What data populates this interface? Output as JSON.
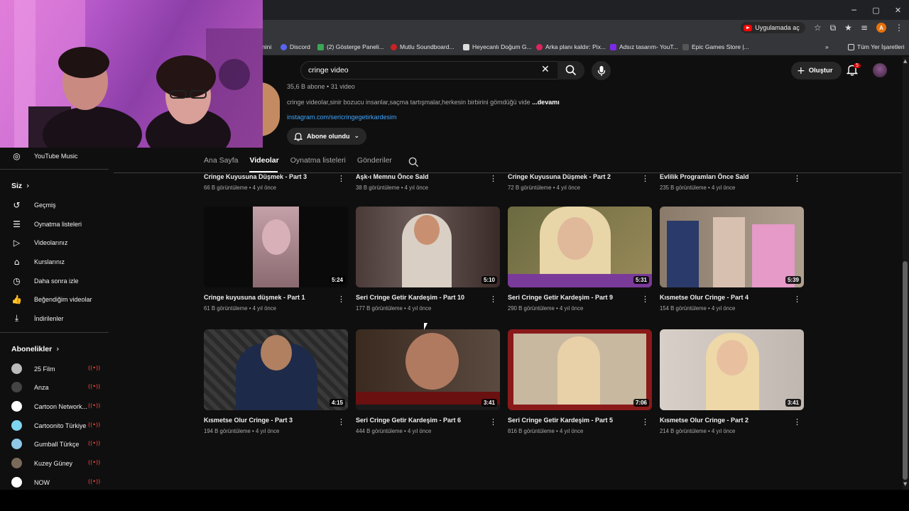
{
  "window": {
    "minimize": "─",
    "maximize": "▢",
    "close": "✕"
  },
  "toolbar": {
    "open_app_label": "Uygulamada aç",
    "profile_initial": "A"
  },
  "bookmarks": [
    {
      "label": "nini",
      "color": "#888888"
    },
    {
      "label": "Discord",
      "color": "#5865f2"
    },
    {
      "label": "(2) Gösterge Paneli...",
      "color": "#3aa757"
    },
    {
      "label": "Mutlu Soundboard...",
      "color": "#cc2222"
    },
    {
      "label": "Heyecanlı Doğum G...",
      "color": "#dddddd"
    },
    {
      "label": "Arka planı kaldır: Pix...",
      "color": "#e0245e"
    },
    {
      "label": "Adsız tasarım- YouT...",
      "color": "#7d2ae8"
    },
    {
      "label": "Epic Games Store |...",
      "color": "#333333"
    }
  ],
  "bookmarks_all": "Tüm Yer İşaretleri",
  "search": {
    "query": "cringe video"
  },
  "header": {
    "create_label": "Oluştur",
    "notif_count": "5"
  },
  "channel": {
    "meta": "35,6 B abone • 31 video",
    "description": "cringe videolar,sinir bozucu insanlar,saçma tartışmalar,herkesin birbirini gömdüğü vide",
    "more": "...devamı",
    "link": "instagram.com/sericringegetirkardesim",
    "subscribed_label": "Abone olundu"
  },
  "tabs": [
    {
      "label": "Ana Sayfa",
      "active": false
    },
    {
      "label": "Videolar",
      "active": true
    },
    {
      "label": "Oynatma listeleri",
      "active": false
    },
    {
      "label": "Gönderiler",
      "active": false
    }
  ],
  "sidebar": {
    "music": {
      "label": "YouTube Music",
      "icon": "youtube-music-icon"
    },
    "you_heading": "Siz",
    "you_items": [
      {
        "label": "Geçmiş",
        "icon": "history-icon"
      },
      {
        "label": "Oynatma listeleri",
        "icon": "playlists-icon"
      },
      {
        "label": "Videolarınız",
        "icon": "your-videos-icon"
      },
      {
        "label": "Kurslarınız",
        "icon": "courses-icon"
      },
      {
        "label": "Daha sonra izle",
        "icon": "watch-later-icon"
      },
      {
        "label": "Beğendiğim videolar",
        "icon": "liked-icon"
      },
      {
        "label": "İndirilenler",
        "icon": "download-icon"
      }
    ],
    "subs_heading": "Abonelikler",
    "subscriptions": [
      {
        "label": "25 Film",
        "color": "#bbbbbb",
        "live": true
      },
      {
        "label": "Anza",
        "color": "#444444",
        "live": true
      },
      {
        "label": "Cartoon Network...",
        "color": "#ffffff",
        "live": true
      },
      {
        "label": "Cartoonito Türkiye",
        "color": "#7fd4f0",
        "live": true
      },
      {
        "label": "Gumball Türkçe",
        "color": "#8fc8e8",
        "live": true
      },
      {
        "label": "Kuzey Güney",
        "color": "#7a6a5a",
        "live": true
      },
      {
        "label": "NOW",
        "color": "#ffffff",
        "live": true
      }
    ]
  },
  "videos_row0": [
    {
      "title": "Cringe Kuyusuna Düşmek - Part 3",
      "meta": "66 B görüntüleme • 4 yıl önce"
    },
    {
      "title": "Aşk-ı Memnu Önce Sald",
      "meta": "38 B görüntüleme • 4 yıl önce"
    },
    {
      "title": "Cringe Kuyusuna Düşmek - Part 2",
      "meta": "72 B görüntüleme • 4 yıl önce"
    },
    {
      "title": "Evlilik Programları Önce Sald",
      "meta": "235 B görüntüleme • 4 yıl önce"
    }
  ],
  "videos_row1": [
    {
      "title": "Cringe kuyusuna düşmek - Part 1",
      "meta": "61 B görüntüleme • 4 yıl önce",
      "duration": "5:24",
      "colors": [
        "#0a0a0a",
        "#a08090"
      ]
    },
    {
      "title": "Seri Cringe Getir Kardeşim - Part 10",
      "meta": "177 B görüntüleme • 4 yıl önce",
      "duration": "5:10",
      "colors": [
        "#5a4a48",
        "#d9cfc4"
      ]
    },
    {
      "title": "Seri Cringe Getir Kardeşim - Part 9",
      "meta": "290 B görüntüleme • 4 yıl önce",
      "duration": "5:31",
      "colors": [
        "#7a7a4e",
        "#e8d6a8"
      ]
    },
    {
      "title": "Kısmetse Olur Cringe - Part 4",
      "meta": "154 B görüntüleme • 4 yıl önce",
      "duration": "5:39",
      "colors": [
        "#8a6e5a",
        "#e59ac8"
      ]
    }
  ],
  "videos_row2": [
    {
      "title": "Kısmetse Olur Cringe - Part 3",
      "meta": "194 B görüntüleme • 4 yıl önce",
      "duration": "4:15",
      "colors": [
        "#3a3a3a",
        "#2a3a5a"
      ]
    },
    {
      "title": "Seri Cringe Getir Kardeşim - Part 6",
      "meta": "444 B görüntüleme • 4 yıl önce",
      "duration": "3:41",
      "colors": [
        "#4a3a30",
        "#b07a60"
      ]
    },
    {
      "title": "Seri Cringe Getir Kardeşim - Part 5",
      "meta": "816 B görüntüleme • 4 yıl önce",
      "duration": "7:06",
      "colors": [
        "#8a1a1a",
        "#e0c8a0"
      ]
    },
    {
      "title": "Kısmetse Olur Cringe - Part 2",
      "meta": "214 B görüntüleme • 4 yıl önce",
      "duration": "3:41",
      "colors": [
        "#d8d0c8",
        "#e8d8a8"
      ]
    }
  ],
  "menu_glyph": "⋮"
}
